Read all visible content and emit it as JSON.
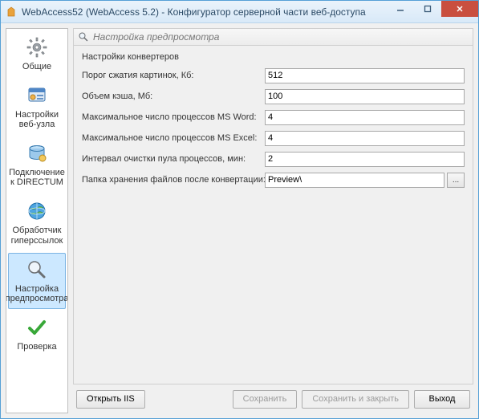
{
  "window": {
    "title": "WebAccess52 (WebAccess 5.2) - Конфигуратор серверной части веб-доступа"
  },
  "sidebar": {
    "items": [
      {
        "label": "Общие"
      },
      {
        "label": "Настройки веб-узла"
      },
      {
        "label": "Подключение к DIRECTUM"
      },
      {
        "label": "Обработчик гиперссылок"
      },
      {
        "label": "Настройка предпросмотра"
      },
      {
        "label": "Проверка"
      }
    ],
    "selected_index": 4
  },
  "section": {
    "title": "Настройка предпросмотра"
  },
  "panel": {
    "group_title": "Настройки конвертеров",
    "fields": {
      "threshold": {
        "label": "Порог сжатия картинок, Кб:",
        "value": "512"
      },
      "cache": {
        "label": "Объем кэша, Мб:",
        "value": "100"
      },
      "word": {
        "label": "Максимальное число процессов MS Word:",
        "value": "4"
      },
      "excel": {
        "label": "Максимальное число процессов MS Excel:",
        "value": "4"
      },
      "interval": {
        "label": "Интервал очистки пула процессов, мин:",
        "value": "2"
      },
      "folder": {
        "label": "Папка хранения файлов после конвертации:",
        "value": "Preview\\"
      }
    },
    "browse_label": "..."
  },
  "footer": {
    "open_iis": "Открыть IIS",
    "save": "Сохранить",
    "save_close": "Сохранить и закрыть",
    "exit": "Выход"
  }
}
